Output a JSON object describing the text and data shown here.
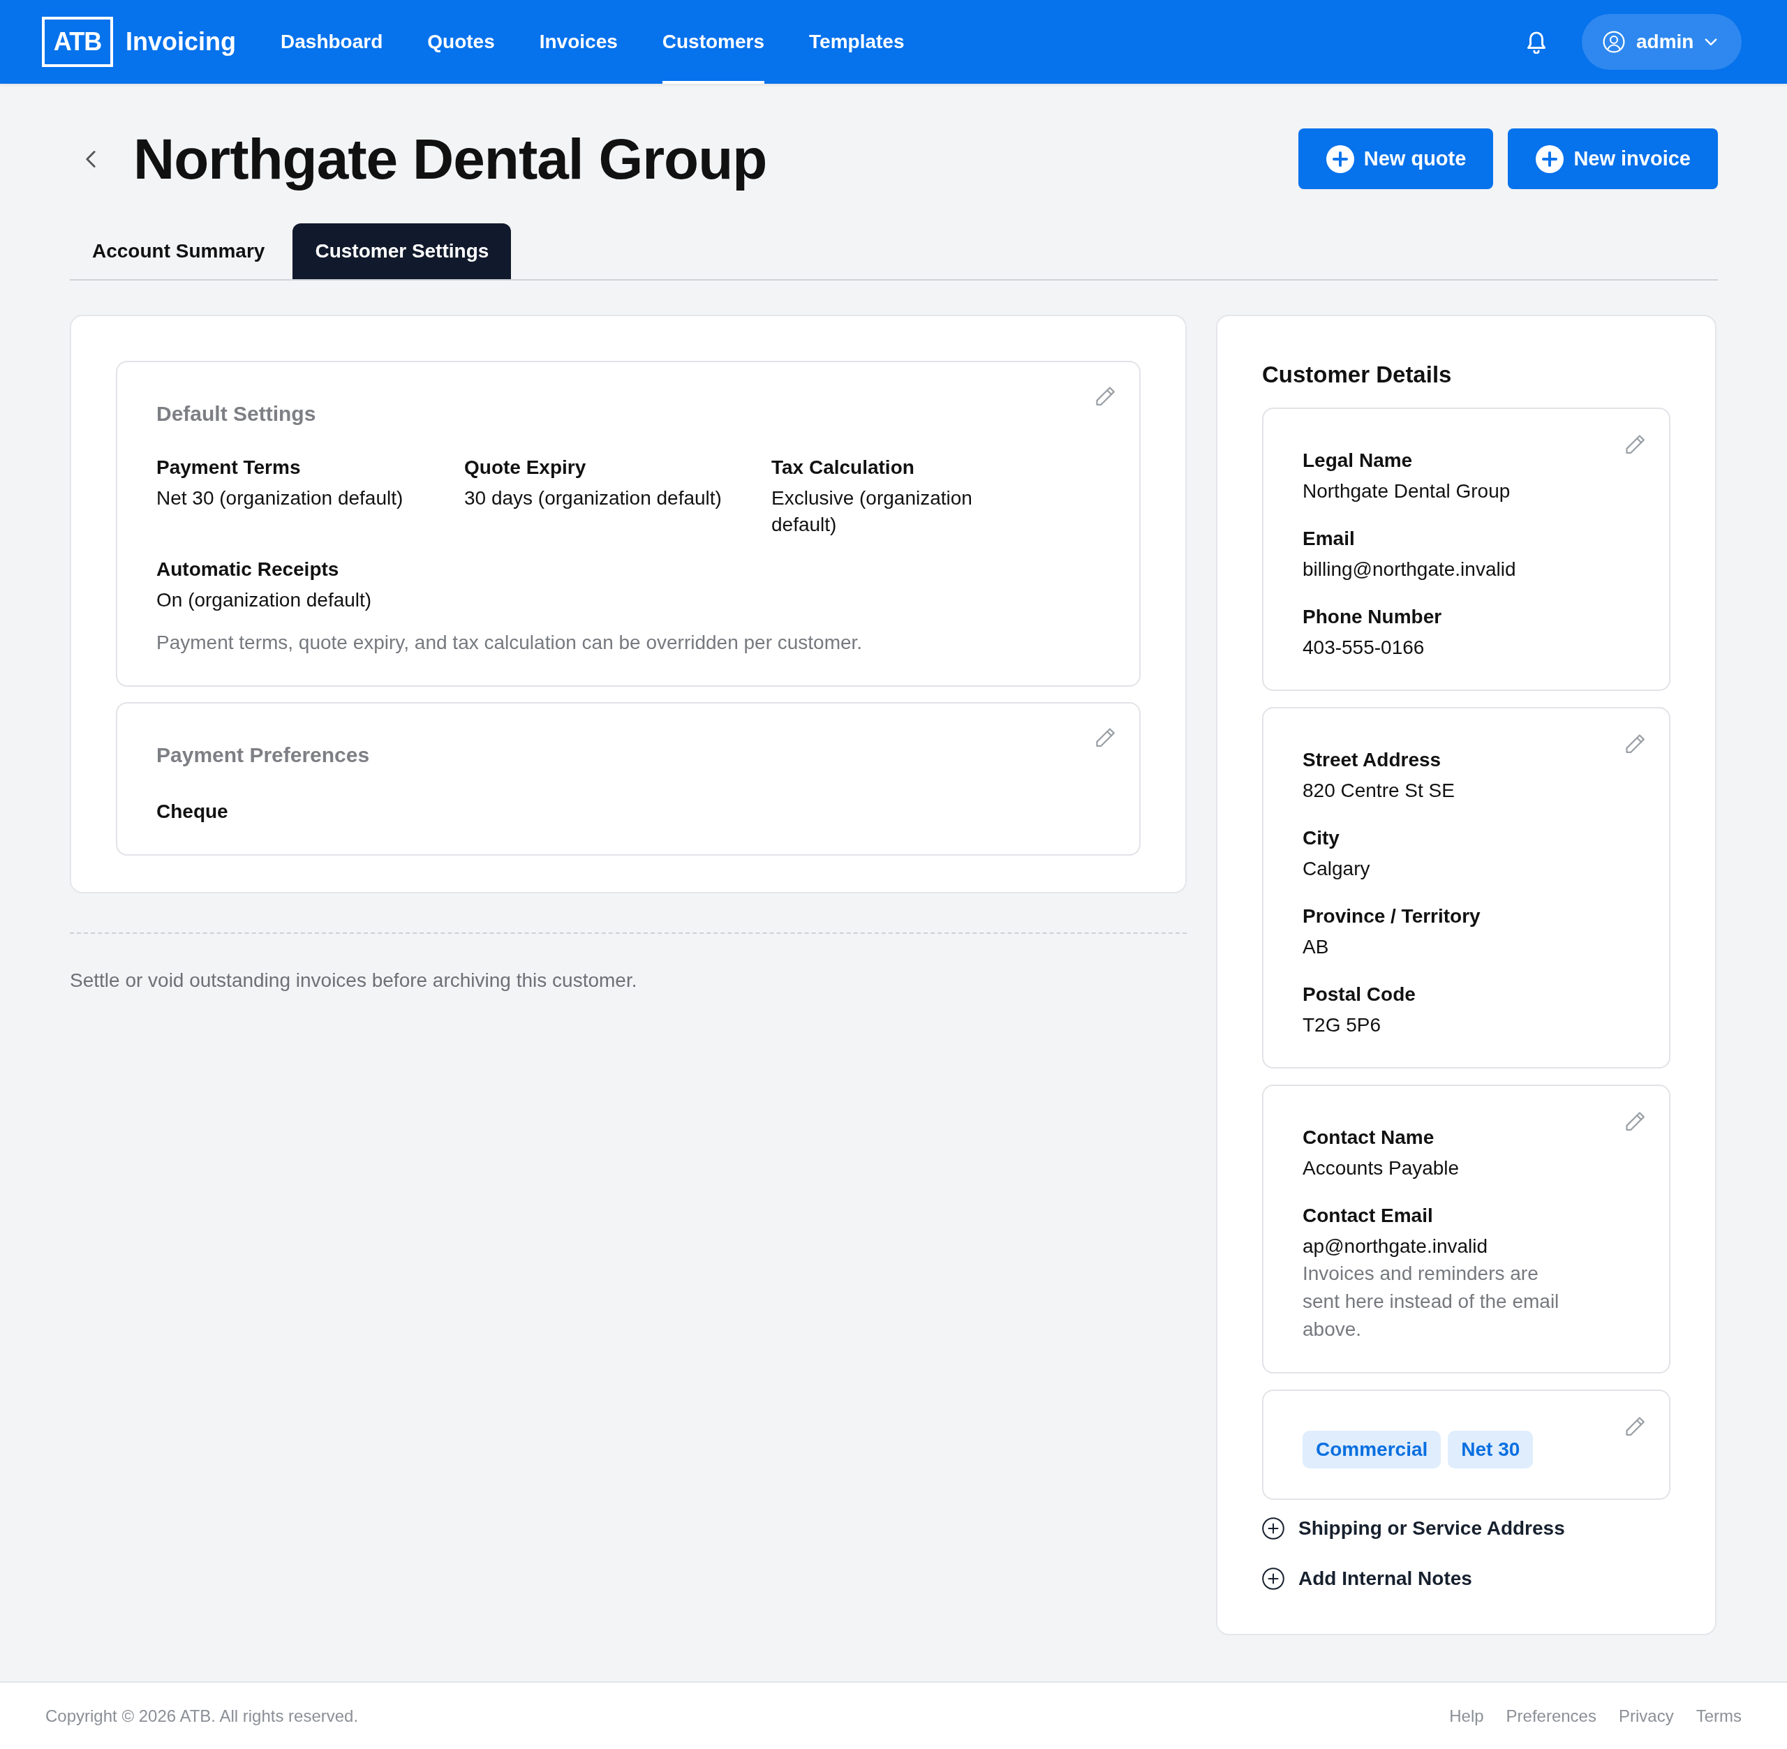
{
  "navbar": {
    "logo": "ATB",
    "app_name": "Invoicing",
    "links": [
      {
        "label": "Dashboard",
        "selected": false
      },
      {
        "label": "Quotes",
        "selected": false
      },
      {
        "label": "Invoices",
        "selected": false
      },
      {
        "label": "Customers",
        "selected": true
      },
      {
        "label": "Templates",
        "selected": false
      }
    ],
    "user": {
      "name": "admin"
    }
  },
  "header": {
    "title": "Northgate Dental Group",
    "actions": [
      "New quote",
      "New invoice"
    ]
  },
  "tabs": [
    {
      "label": "Account Summary",
      "selected": false
    },
    {
      "label": "Customer Settings",
      "selected": true
    }
  ],
  "settings": {
    "sections": [
      {
        "kind": "fields",
        "title": "Default Settings",
        "fields": [
          {
            "label": "Payment Terms",
            "value": "Net 30 (organization default)"
          },
          {
            "label": "Quote Expiry",
            "value": "30 days (organization default)"
          },
          {
            "label": "Tax Calculation",
            "value": "Exclusive (organization default)"
          },
          {
            "label": "Automatic Receipts",
            "value": "On (organization default)"
          }
        ],
        "note": "Payment terms, quote expiry, and tax calculation can be overridden per customer."
      },
      {
        "kind": "options",
        "title": "Payment Preferences",
        "options": [
          "Cheque"
        ]
      }
    ],
    "archive_note": "Settle or void outstanding invoices before archiving this customer."
  },
  "customer_details": {
    "title": "Customer Details",
    "groups": [
      {
        "kind": "fields",
        "fields": [
          {
            "label": "Legal Name",
            "value": "Northgate Dental Group"
          },
          {
            "label": "Email",
            "value": "billing@northgate.invalid"
          },
          {
            "label": "Phone Number",
            "value": "403-555-0166"
          }
        ]
      },
      {
        "kind": "fields",
        "fields": [
          {
            "label": "Street Address",
            "value": "820 Centre St SE"
          },
          {
            "label": "City",
            "value": "Calgary"
          },
          {
            "label": "Province / Territory",
            "value": "AB"
          },
          {
            "label": "Postal Code",
            "value": "T2G 5P6"
          }
        ]
      },
      {
        "kind": "fields",
        "fields": [
          {
            "label": "Contact Name",
            "value": "Accounts Payable"
          },
          {
            "label": "Contact Email",
            "value": "ap@northgate.invalid",
            "hint": "Invoices and reminders are sent here instead of the email above."
          }
        ]
      },
      {
        "kind": "tags",
        "tags": [
          "Commercial",
          "Net 30"
        ]
      }
    ],
    "add_links": [
      "Shipping or Service Address",
      "Add Internal Notes"
    ]
  },
  "footer": {
    "copyright": "Copyright © 2026 ATB. All rights reserved.",
    "links": [
      "Help",
      "Preferences",
      "Privacy",
      "Terms"
    ]
  }
}
